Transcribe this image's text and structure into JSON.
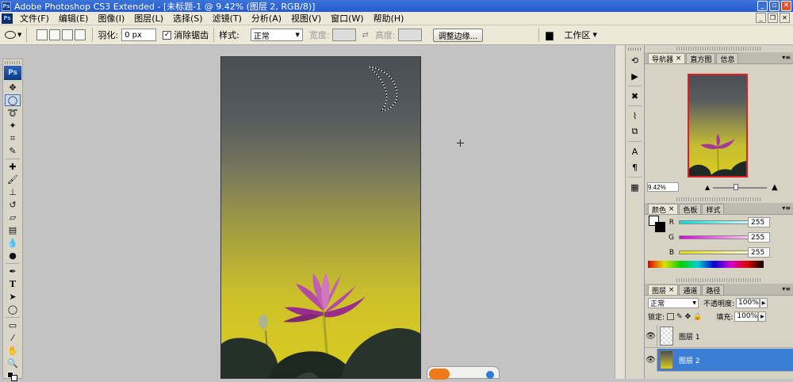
{
  "window": {
    "title": "Adobe Photoshop CS3 Extended - [未标题-1 @ 9.42% (图层 2, RGB/8)]",
    "app_icon": "Ps",
    "controls": [
      "minimize",
      "maximize",
      "close"
    ]
  },
  "menubar": {
    "items": [
      "文件(F)",
      "编辑(E)",
      "图像(I)",
      "图层(L)",
      "选择(S)",
      "滤镜(T)",
      "分析(A)",
      "视图(V)",
      "窗口(W)",
      "帮助(H)"
    ]
  },
  "options": {
    "feather_label": "羽化:",
    "feather_value": "0 px",
    "antialias_label": "消除锯齿",
    "antialias_checked": true,
    "style_label": "样式:",
    "style_value": "正常",
    "width_label": "宽度:",
    "height_label": "高度:",
    "refine_edge": "调整边缘...",
    "workspace": "工作区"
  },
  "toolbox": {
    "logo": "Ps",
    "tools": [
      "move-tool",
      "elliptical-marquee-tool",
      "lasso-tool",
      "magic-wand-tool",
      "crop-tool",
      "eyedropper-tool",
      "healing-brush-tool",
      "brush-tool",
      "clone-stamp-tool",
      "history-brush-tool",
      "eraser-tool",
      "gradient-tool",
      "blur-tool",
      "dodge-tool",
      "pen-tool",
      "type-tool",
      "path-selection-tool",
      "shape-tool",
      "notes-tool",
      "eyedropper2-tool",
      "hand-tool",
      "zoom-tool"
    ]
  },
  "navigator": {
    "tabs": [
      "导航器",
      "直方图",
      "信息"
    ],
    "zoom": "9.42%"
  },
  "color": {
    "tabs": [
      "颜色",
      "色板",
      "样式"
    ],
    "channels": [
      {
        "label": "R",
        "value": "255",
        "color": "#00e0e0"
      },
      {
        "label": "G",
        "value": "255",
        "color": "#e000e0"
      },
      {
        "label": "B",
        "value": "255",
        "color": "#e0e000"
      }
    ]
  },
  "layers": {
    "tabs": [
      "图层",
      "通道",
      "路径"
    ],
    "blend_mode": "正常",
    "opacity_label": "不透明度:",
    "opacity_value": "100%",
    "lock_label": "锁定:",
    "fill_label": "填充:",
    "fill_value": "100%",
    "items": [
      {
        "name": "图层 1",
        "selected": false
      },
      {
        "name": "图层 2",
        "selected": true
      }
    ]
  },
  "colors": {
    "selection": "#3c7ed6",
    "title_bar": "#245ad0",
    "lotus": "#9a2d8c"
  }
}
